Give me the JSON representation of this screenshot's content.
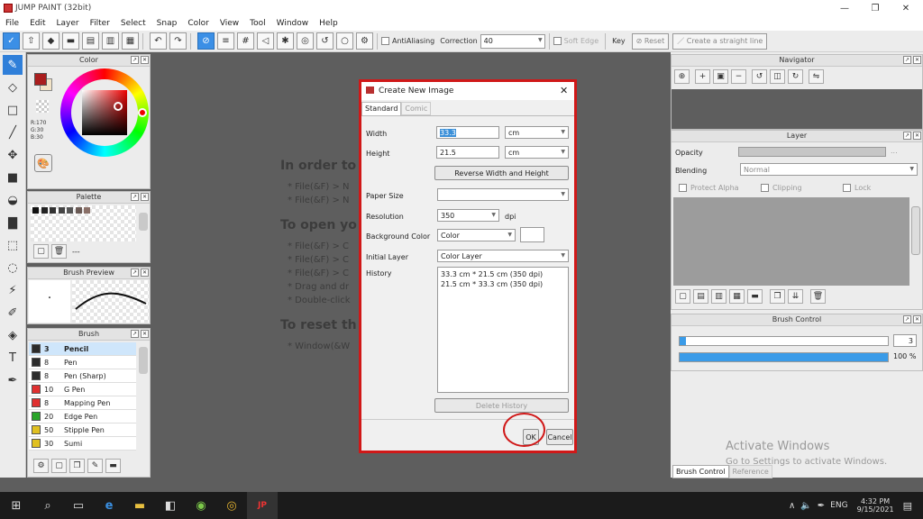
{
  "app": {
    "title": "JUMP PAINT (32bit)"
  },
  "window_controls": {
    "minimize": "—",
    "maximize": "❐",
    "close": "✕"
  },
  "menu": [
    "File",
    "Edit",
    "Layer",
    "Filter",
    "Select",
    "Snap",
    "Color",
    "View",
    "Tool",
    "Window",
    "Help"
  ],
  "toolbar": {
    "antialiasing_label": "AntiAliasing",
    "correction_label": "Correction",
    "correction_value": "40",
    "soft_edge_label": "Soft Edge",
    "key_label": "Key",
    "reset_label": "Reset",
    "straight_line_label": "Create a straight line"
  },
  "color_panel": {
    "title": "Color",
    "r": "R:170",
    "g": "G:30",
    "b": "B:30",
    "primary_color": "#aa1e1e"
  },
  "palette_panel": {
    "title": "Palette",
    "dash": "---"
  },
  "brush_preview_panel": {
    "title": "Brush Preview",
    "dot": "·"
  },
  "brush_panel": {
    "title": "Brush",
    "items": [
      {
        "size": "3",
        "name": "Pencil",
        "color": "#2b2b2b"
      },
      {
        "size": "8",
        "name": "Pen",
        "color": "#2b2b2b"
      },
      {
        "size": "8",
        "name": "Pen (Sharp)",
        "color": "#2b2b2b"
      },
      {
        "size": "10",
        "name": "G Pen",
        "color": "#e03030"
      },
      {
        "size": "8",
        "name": "Mapping Pen",
        "color": "#e03030"
      },
      {
        "size": "20",
        "name": "Edge Pen",
        "color": "#2aa52a"
      },
      {
        "size": "50",
        "name": "Stipple Pen",
        "color": "#e0c020"
      },
      {
        "size": "30",
        "name": "Sumi",
        "color": "#e0c020"
      }
    ]
  },
  "canvas_bg": {
    "h1": "In order to",
    "l1a": "* File(&F) > N",
    "l1b": "* File(&F) > N",
    "h2": "To open yo",
    "l2a": "* File(&F) > C",
    "l2b": "* File(&F) > C",
    "l2c": "* File(&F) > C",
    "l2d": "* Drag and dr",
    "l2e": "* Double-click",
    "h3": "To reset th",
    "l3a": "* Window(&W"
  },
  "navigator_panel": {
    "title": "Navigator"
  },
  "layer_panel": {
    "title": "Layer",
    "opacity_label": "Opacity",
    "blending_label": "Blending",
    "blending_value": "Normal",
    "protect_alpha": "Protect Alpha",
    "clipping": "Clipping",
    "lock": "Lock",
    "opacity_dots": "..."
  },
  "brush_control_panel": {
    "title": "Brush Control",
    "size_value": "3",
    "opacity_value": "100 %",
    "size_fraction": 0.03,
    "opacity_fraction": 1.0
  },
  "bottom_tabs": {
    "brush_control": "Brush Control",
    "reference": "Reference"
  },
  "dialog": {
    "title": "Create New Image",
    "close": "✕",
    "tabs": [
      "Standard",
      "Comic"
    ],
    "width_label": "Width",
    "width_value": "33.3",
    "width_unit": "cm",
    "height_label": "Height",
    "height_value": "21.5",
    "height_unit": "cm",
    "reverse_button": "Reverse Width and Height",
    "paper_size_label": "Paper Size",
    "paper_size_value": "",
    "resolution_label": "Resolution",
    "resolution_value": "350",
    "resolution_unit": "dpi",
    "bg_color_label": "Background Color",
    "bg_color_value": "Color",
    "initial_layer_label": "Initial Layer",
    "initial_layer_value": "Color Layer",
    "history_label": "History",
    "history": [
      "33.3 cm * 21.5 cm (350 dpi)",
      "21.5 cm * 33.3 cm (350 dpi)"
    ],
    "delete_history_button": "Delete History",
    "ok_button": "OK",
    "cancel_button": "Cancel"
  },
  "watermark": {
    "line1": "Activate Windows",
    "line2": "Go to Settings to activate Windows."
  },
  "taskbar": {
    "lang": "ENG",
    "time": "4:32 PM",
    "date": "9/15/2021"
  }
}
